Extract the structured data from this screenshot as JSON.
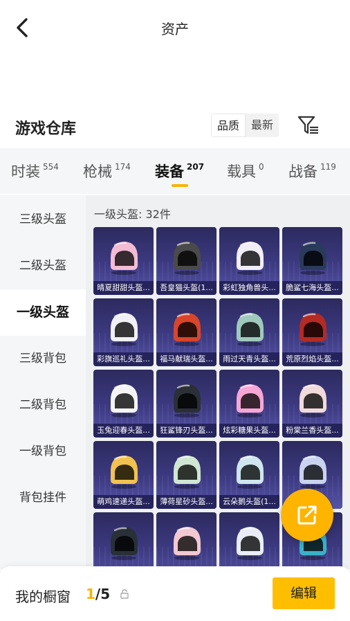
{
  "header": {
    "title": "资产"
  },
  "section": {
    "title": "游戏仓库",
    "sort_options": [
      "品质",
      "最新"
    ]
  },
  "tabs": [
    {
      "label": "时装",
      "count": "554"
    },
    {
      "label": "枪械",
      "count": "174"
    },
    {
      "label": "装备",
      "count": "207"
    },
    {
      "label": "载具",
      "count": "0"
    },
    {
      "label": "战备",
      "count": "119"
    }
  ],
  "sidebar": [
    "三级头盔",
    "二级头盔",
    "一级头盔",
    "三级背包",
    "二级背包",
    "一级背包",
    "背包挂件"
  ],
  "content": {
    "title": "一级头盔: 32件"
  },
  "items": [
    {
      "name": "晴夏甜甜头盔...",
      "color": "#f3bcd4"
    },
    {
      "name": "吾皇猫头盔(1...",
      "color": "#4a4a4a"
    },
    {
      "name": "彩虹独角兽头...",
      "color": "#f2eef5"
    },
    {
      "name": "脆鲨七海头盔...",
      "color": "#2a3a5a"
    },
    {
      "name": "彩旗巡礼头盔...",
      "color": "#f0f0f5"
    },
    {
      "name": "福马献瑞头盔...",
      "color": "#d9452a"
    },
    {
      "name": "雨过天青头盔...",
      "color": "#9fc9bd"
    },
    {
      "name": "荒原烈焰头盔...",
      "color": "#b42a24"
    },
    {
      "name": "玉兔迎春头盔...",
      "color": "#f4f4f4"
    },
    {
      "name": "狂鲨锋刃头盔...",
      "color": "#2b2f36"
    },
    {
      "name": "炫彩糖果头盔...",
      "color": "#f6a7d6"
    },
    {
      "name": "粉棠兰香头盔...",
      "color": "#f0dada"
    },
    {
      "name": "萌鸡速递头盔...",
      "color": "#f1c24f"
    },
    {
      "name": "薄荷星砂头盔...",
      "color": "#cfe6d3"
    },
    {
      "name": "云朵鹅头盔(1...",
      "color": "#cfe6ee"
    },
    {
      "name": "",
      "color": "#c9d3ef"
    },
    {
      "name": "",
      "color": "#2a3038"
    },
    {
      "name": "",
      "color": "#f2c8d2"
    },
    {
      "name": "",
      "color": "#e9eef6"
    },
    {
      "name": "",
      "color": "#3bb0c8"
    }
  ],
  "footer": {
    "label": "我的橱窗",
    "current": "1",
    "total": "/5",
    "edit_label": "编辑"
  },
  "colors": {
    "accent": "#f6b400",
    "button": "#ffbf00",
    "card": "#3d3a82"
  }
}
